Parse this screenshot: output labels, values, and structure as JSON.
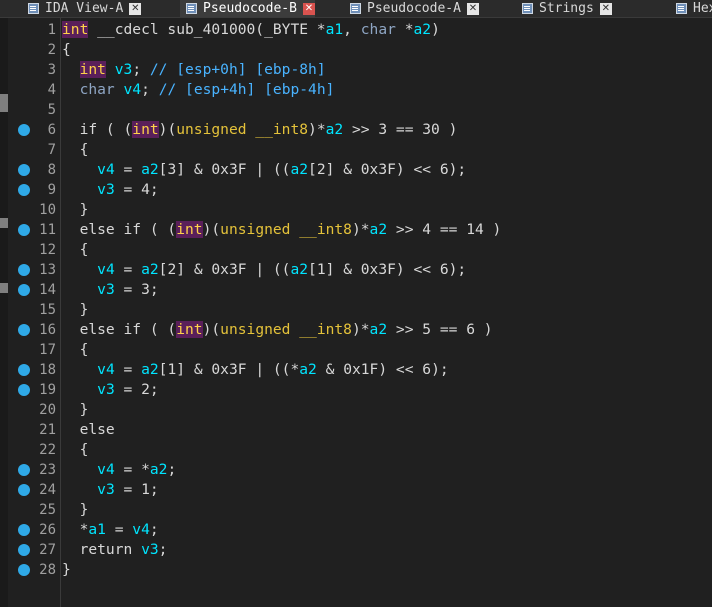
{
  "tabs": [
    {
      "label": "IDA View-A",
      "active": false
    },
    {
      "label": "Pseudocode-B",
      "active": true
    },
    {
      "label": "Pseudocode-A",
      "active": false
    },
    {
      "label": "Strings",
      "active": false
    },
    {
      "label": "Hex",
      "active": false
    }
  ],
  "colors": {
    "background": "#202020",
    "breakpoint": "#2fa9e7",
    "variable": "#00e5ff",
    "type_highlight_bg": "#5a1f5a"
  },
  "code": {
    "lines": [
      {
        "n": "1",
        "bp": false,
        "text": "int __cdecl sub_401000(_BYTE *a1, char *a2)"
      },
      {
        "n": "2",
        "bp": false,
        "text": "{"
      },
      {
        "n": "3",
        "bp": false,
        "text": "  int v3; // [esp+0h] [ebp-8h]"
      },
      {
        "n": "4",
        "bp": false,
        "text": "  char v4; // [esp+4h] [ebp-4h]"
      },
      {
        "n": "5",
        "bp": false,
        "text": ""
      },
      {
        "n": "6",
        "bp": true,
        "text": "  if ( (int)(unsigned __int8)*a2 >> 3 == 30 )"
      },
      {
        "n": "7",
        "bp": false,
        "text": "  {"
      },
      {
        "n": "8",
        "bp": true,
        "text": "    v4 = a2[3] & 0x3F | ((a2[2] & 0x3F) << 6);"
      },
      {
        "n": "9",
        "bp": true,
        "text": "    v3 = 4;"
      },
      {
        "n": "10",
        "bp": false,
        "text": "  }"
      },
      {
        "n": "11",
        "bp": true,
        "text": "  else if ( (int)(unsigned __int8)*a2 >> 4 == 14 )"
      },
      {
        "n": "12",
        "bp": false,
        "text": "  {"
      },
      {
        "n": "13",
        "bp": true,
        "text": "    v4 = a2[2] & 0x3F | ((a2[1] & 0x3F) << 6);"
      },
      {
        "n": "14",
        "bp": true,
        "text": "    v3 = 3;"
      },
      {
        "n": "15",
        "bp": false,
        "text": "  }"
      },
      {
        "n": "16",
        "bp": true,
        "text": "  else if ( (int)(unsigned __int8)*a2 >> 5 == 6 )"
      },
      {
        "n": "17",
        "bp": false,
        "text": "  {"
      },
      {
        "n": "18",
        "bp": true,
        "text": "    v4 = a2[1] & 0x3F | ((*a2 & 0x1F) << 6);"
      },
      {
        "n": "19",
        "bp": true,
        "text": "    v3 = 2;"
      },
      {
        "n": "20",
        "bp": false,
        "text": "  }"
      },
      {
        "n": "21",
        "bp": false,
        "text": "  else"
      },
      {
        "n": "22",
        "bp": false,
        "text": "  {"
      },
      {
        "n": "23",
        "bp": true,
        "text": "    v4 = *a2;"
      },
      {
        "n": "24",
        "bp": true,
        "text": "    v3 = 1;"
      },
      {
        "n": "25",
        "bp": false,
        "text": "  }"
      },
      {
        "n": "26",
        "bp": true,
        "text": "  *a1 = v4;"
      },
      {
        "n": "27",
        "bp": true,
        "text": "  return v3;"
      },
      {
        "n": "28",
        "bp": true,
        "text": "}"
      }
    ]
  }
}
